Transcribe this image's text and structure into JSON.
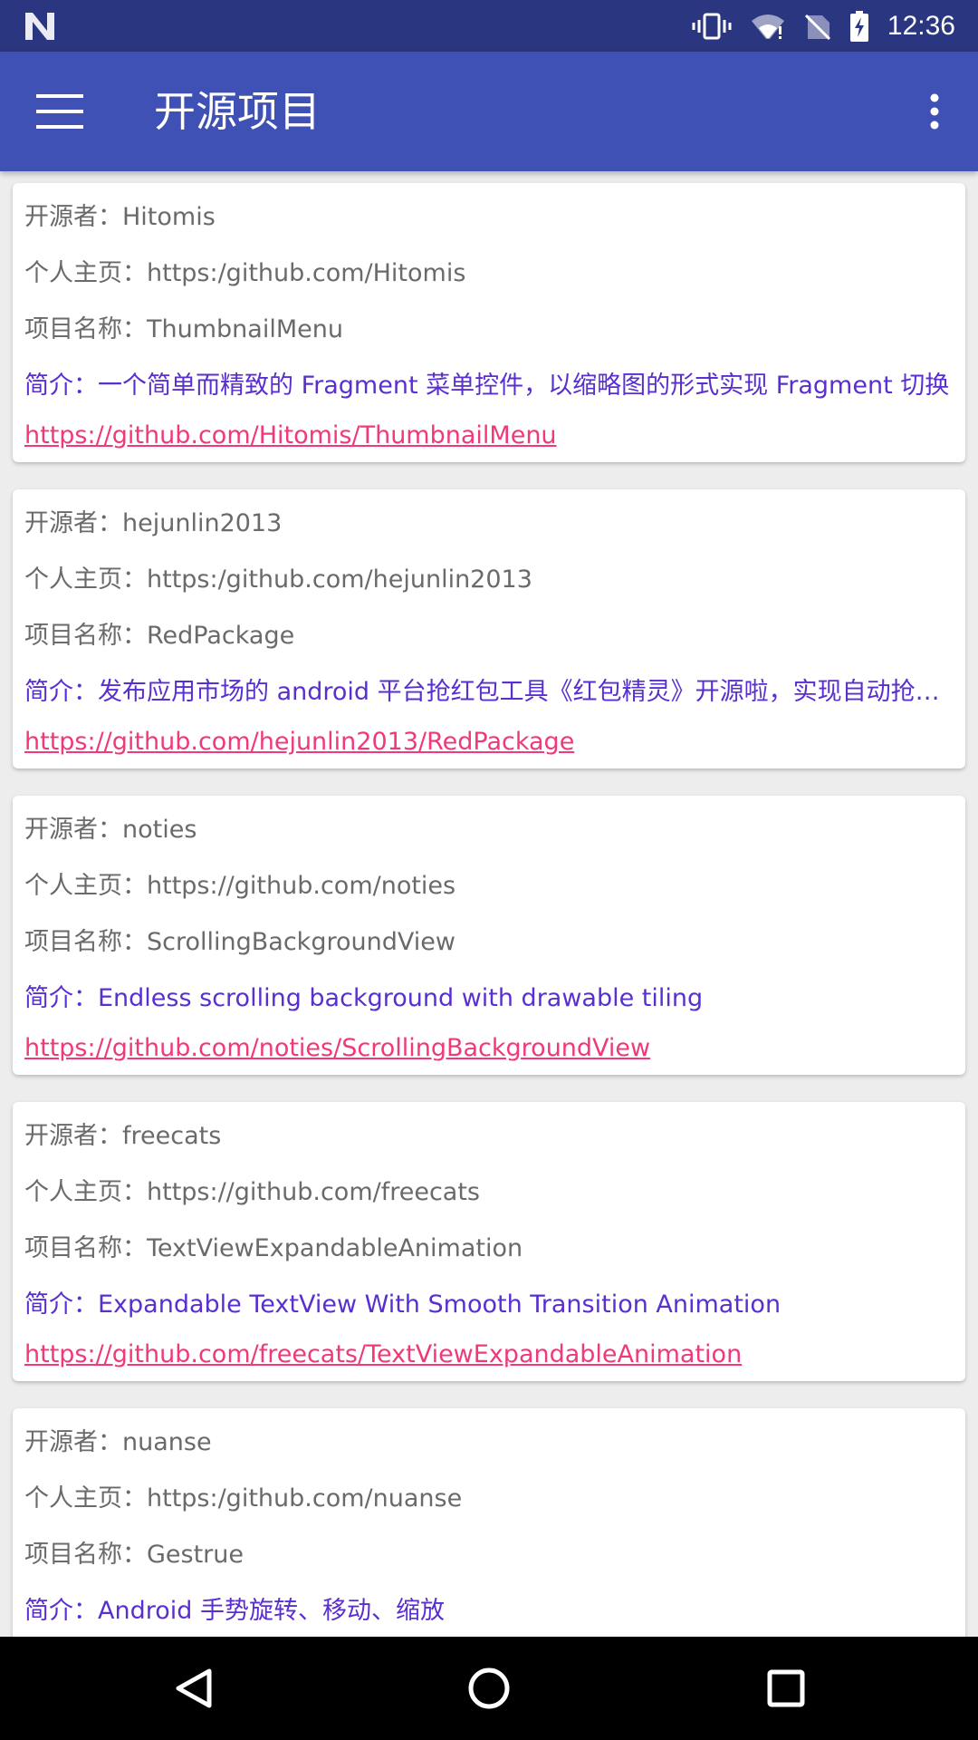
{
  "status_bar": {
    "time": "12:36",
    "icons": [
      "n-logo-icon",
      "vibrate-icon",
      "wifi-icon",
      "no-sim-icon",
      "battery-charging-icon"
    ]
  },
  "app_bar": {
    "title": "开源项目",
    "menu_icon": "hamburger-menu-icon",
    "overflow_icon": "more-vert-icon",
    "color": "#3f51b5"
  },
  "colors": {
    "status_bar": "#2a3680",
    "meta_text": "#6a6a6a",
    "description_text": "#5a2fd0",
    "link_text": "#f0397a"
  },
  "projects": [
    {
      "author": "开源者：Hitomis",
      "homepage": "个人主页：https:/github.com/Hitomis",
      "name": "项目名称：ThumbnailMenu",
      "description": "简介：一个简单而精致的 Fragment 菜单控件，以缩略图的形式实现 Fragment 切换",
      "link": "https://github.com/Hitomis/ThumbnailMenu"
    },
    {
      "author": "开源者：hejunlin2013",
      "homepage": "个人主页：https:/github.com/hejunlin2013",
      "name": "项目名称：RedPackage",
      "description": "简介：发布应用市场的 android 平台抢红包工具《红包精灵》开源啦，实现自动抢…",
      "link": "https://github.com/hejunlin2013/RedPackage"
    },
    {
      "author": "开源者：noties",
      "homepage": "个人主页：https://github.com/noties",
      "name": "项目名称：ScrollingBackgroundView",
      "description": "简介：Endless scrolling background with drawable tiling",
      "link": "https://github.com/noties/ScrollingBackgroundView"
    },
    {
      "author": "开源者：freecats",
      "homepage": "个人主页：https://github.com/freecats",
      "name": "项目名称：TextViewExpandableAnimation",
      "description": "简介：Expandable TextView With Smooth Transition Animation",
      "link": "https://github.com/freecats/TextViewExpandableAnimation"
    },
    {
      "author": "开源者：nuanse",
      "homepage": "个人主页：https:/github.com/nuanse",
      "name": "项目名称：Gestrue",
      "description": "简介：Android 手势旋转、移动、缩放",
      "link": ""
    }
  ],
  "nav_bar": {
    "back_icon": "back-triangle-icon",
    "home_icon": "home-circle-icon",
    "recents_icon": "recents-square-icon"
  }
}
